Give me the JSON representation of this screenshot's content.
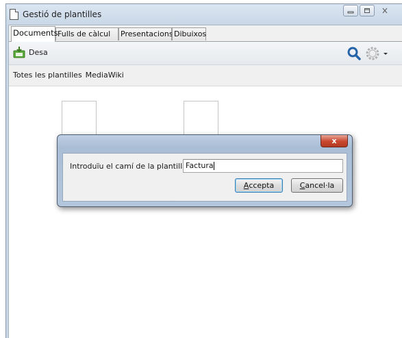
{
  "window": {
    "title": "Gestió de plantilles",
    "caption_buttons": [
      "minimize",
      "maximize",
      "close"
    ]
  },
  "tabs": [
    {
      "label": "Documents",
      "active": true
    },
    {
      "label": "Fulls de càlcul",
      "active": false
    },
    {
      "label": "Presentacions",
      "active": false
    },
    {
      "label": "Dibuixos",
      "active": false
    }
  ],
  "toolbar": {
    "save_label": "Desa",
    "save_icon": "save-icon",
    "search_icon": "search-icon",
    "settings_icon": "gear-icon",
    "settings_dropdown_icon": "dropdown-arrow-icon"
  },
  "breadcrumb": {
    "items": [
      "Totes les plantilles",
      "MediaWiki"
    ]
  },
  "dialog": {
    "close_symbol": "x",
    "prompt_label": "Introduïu el camí de la plantilla:",
    "input_value": "Factura",
    "ok_mnemonic": "A",
    "ok_rest": "ccepta",
    "cancel_mnemonic": "C",
    "cancel_rest": "ancel·la"
  },
  "colors": {
    "accent_search": "#2563a8",
    "dialog_close": "#c9472f"
  }
}
